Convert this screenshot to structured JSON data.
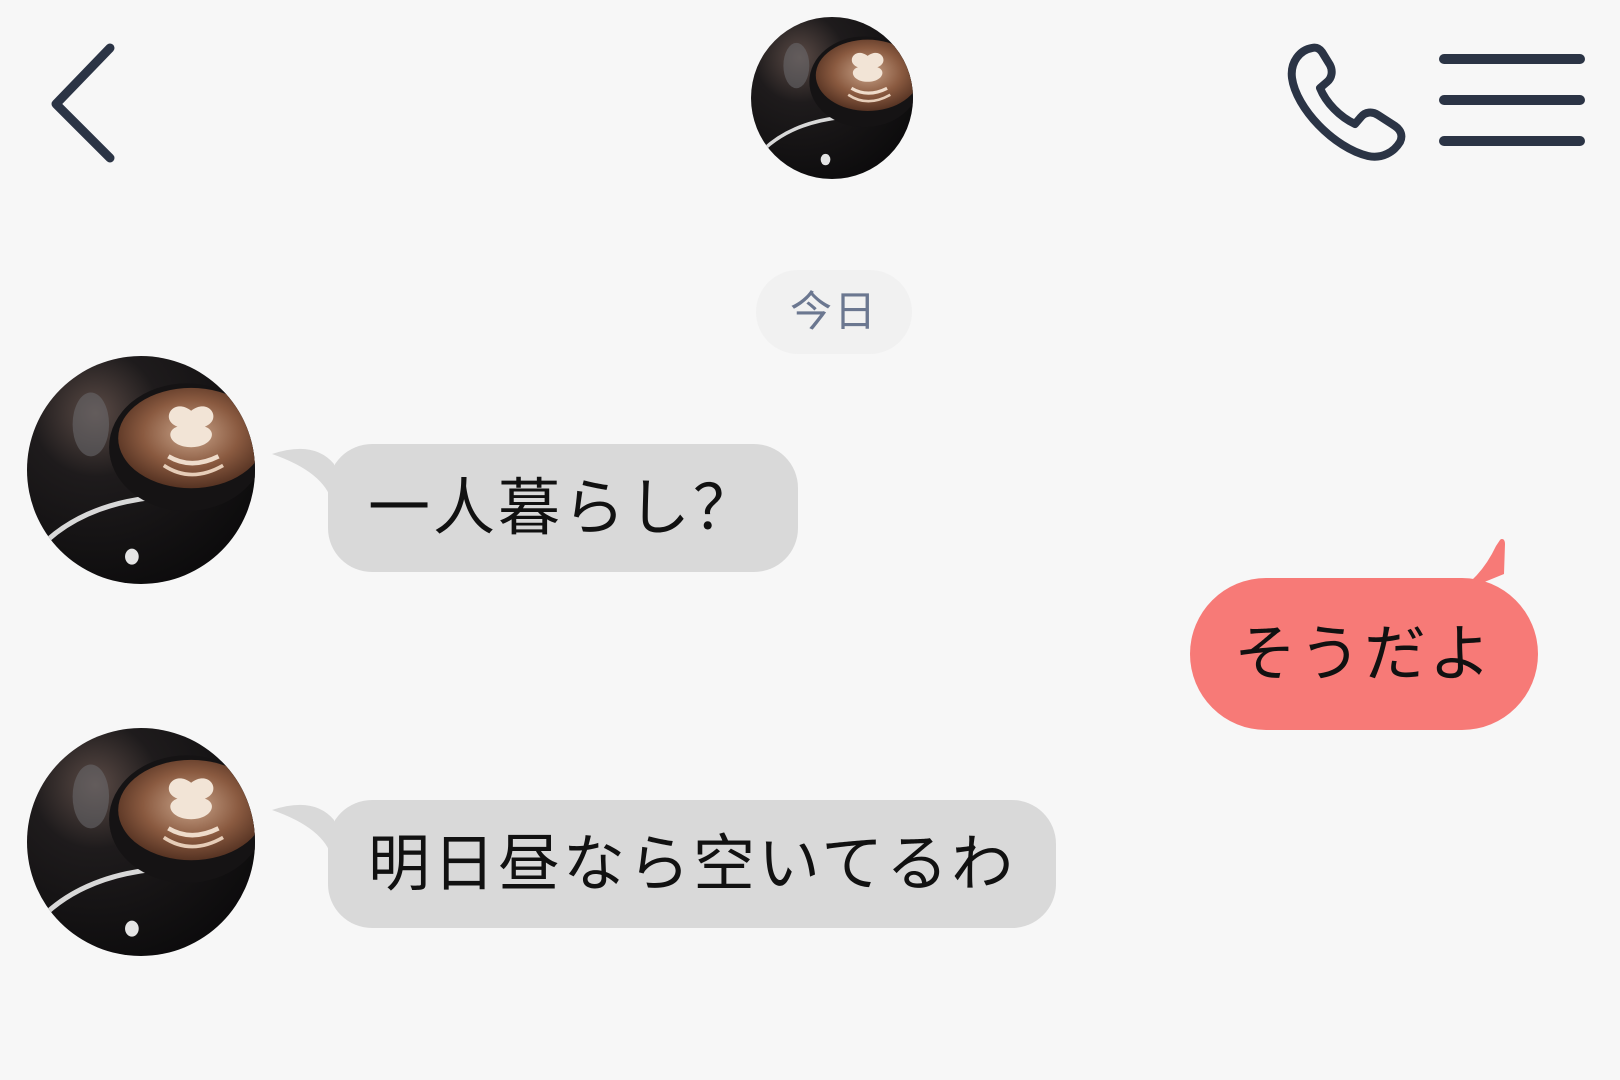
{
  "header": {
    "back_icon": "chevron-left-icon",
    "contact_avatar": "latte-art-coffee-photo",
    "call_icon": "phone-icon",
    "menu_icon": "hamburger-menu-icon"
  },
  "chat": {
    "date_divider": "今日",
    "messages": [
      {
        "sender": "them",
        "text": "一人暮らし？"
      },
      {
        "sender": "me",
        "text": "そうだよ"
      },
      {
        "sender": "them",
        "text": "明日昼なら空いてるわ"
      }
    ]
  },
  "colors": {
    "background": "#f7f7f7",
    "incoming_bubble": "#d9d9d9",
    "outgoing_bubble": "#f77a77",
    "icon": "#2b3445",
    "date_text": "#6b7790"
  }
}
